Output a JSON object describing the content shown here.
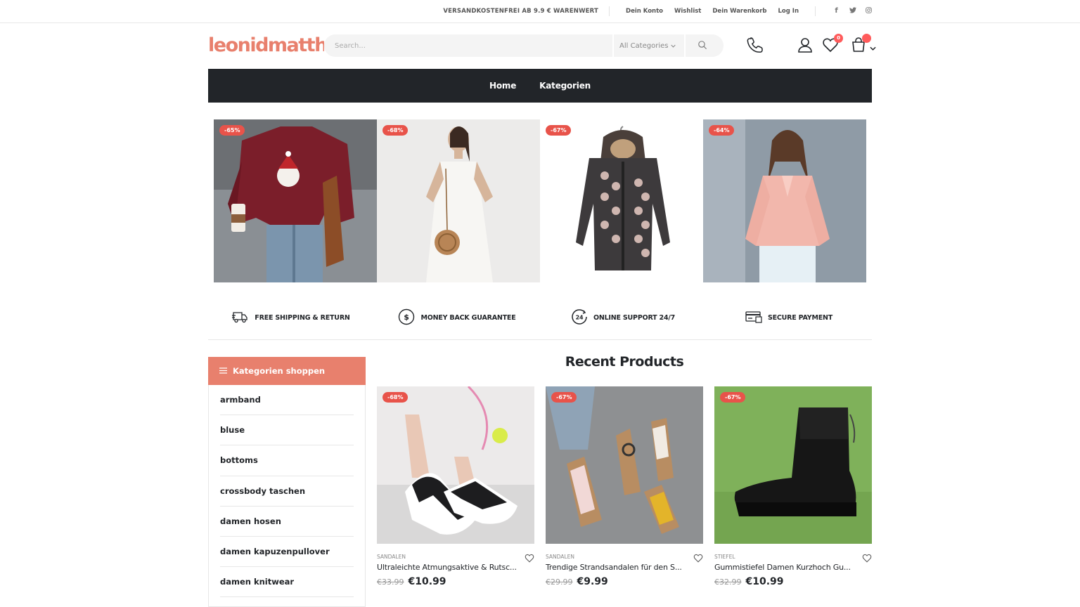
{
  "topbar": {
    "promo": "VERSANDKOSTENFREI AB 9.9 € WARENWERT",
    "links": [
      "Dein Konto",
      "Wishlist",
      "Dein Warenkorb",
      "Log In"
    ],
    "social": [
      "facebook-icon",
      "twitter-icon",
      "instagram-icon"
    ]
  },
  "header": {
    "logo": "leonidmatth",
    "search_placeholder": "Search...",
    "category_select": "All Categories",
    "wishlist_count": "0",
    "cart_count": ""
  },
  "nav": {
    "items": [
      "Home",
      "Kategorien"
    ]
  },
  "banners": [
    {
      "discount": "-65%",
      "subject": "red-sweater-santa"
    },
    {
      "discount": "-68%",
      "subject": "white-dress"
    },
    {
      "discount": "-67%",
      "subject": "patterned-hooded-coat"
    },
    {
      "discount": "-64%",
      "subject": "pink-blouse"
    }
  ],
  "features": [
    {
      "label": "FREE SHIPPING & RETURN",
      "icon": "truck-icon"
    },
    {
      "label": "MONEY BACK GUARANTEE",
      "icon": "dollar-icon"
    },
    {
      "label": "ONLINE SUPPORT 24/7",
      "icon": "support-24-icon"
    },
    {
      "label": "SECURE PAYMENT",
      "icon": "card-icon"
    }
  ],
  "sidebar": {
    "title": "Kategorien shoppen",
    "items": [
      "armband",
      "bluse",
      "bottoms",
      "crossbody taschen",
      "damen hosen",
      "damen kapuzenpullover",
      "damen knitwear"
    ]
  },
  "recent": {
    "title": "Recent Products",
    "products": [
      {
        "discount": "-68%",
        "category": "SANDALEN",
        "name": "Ultraleichte Atmungsaktive & Rutsc...",
        "old_price": "€33.99",
        "price": "€10.99"
      },
      {
        "discount": "-67%",
        "category": "SANDALEN",
        "name": "Trendige Strandsandalen für den S...",
        "old_price": "€29.99",
        "price": "€9.99"
      },
      {
        "discount": "-67%",
        "category": "STIEFEL",
        "name": "Gummistiefel Damen Kurzhoch Gu...",
        "old_price": "€32.99",
        "price": "€10.99"
      }
    ]
  },
  "colors": {
    "accent": "#e8806d",
    "dark": "#222529",
    "badge": "#e8534a"
  }
}
